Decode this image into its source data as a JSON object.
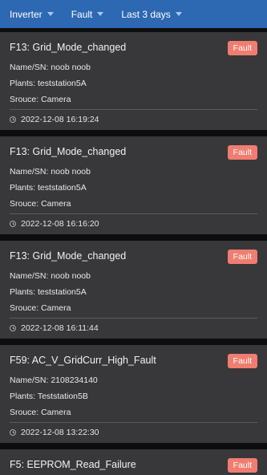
{
  "filters": [
    {
      "label": "Inverter",
      "icon": "caret-down-icon"
    },
    {
      "label": "Fault",
      "icon": "caret-down-icon"
    },
    {
      "label": "Last 3 days",
      "icon": "caret-down-icon"
    }
  ],
  "colors": {
    "header_bg": "#2d68b3",
    "card_bg": "#38383a",
    "badge_bg": "#ef7d70",
    "page_bg": "#0d0d0f"
  },
  "alerts": [
    {
      "title": "F13: Grid_Mode_changed",
      "badge": "Fault",
      "name_sn": "Name/SN: noob noob",
      "plants": "Plants: teststation5A",
      "source": "Srouce: Camera",
      "time": "2022-12-08 16:19:24"
    },
    {
      "title": "F13: Grid_Mode_changed",
      "badge": "Fault",
      "name_sn": "Name/SN: noob noob",
      "plants": "Plants: teststation5A",
      "source": "Srouce: Camera",
      "time": "2022-12-08 16:16:20"
    },
    {
      "title": "F13: Grid_Mode_changed",
      "badge": "Fault",
      "name_sn": "Name/SN: noob noob",
      "plants": "Plants: teststation5A",
      "source": "Srouce: Camera",
      "time": "2022-12-08 16:11:44"
    },
    {
      "title": "F59: AC_V_GridCurr_High_Fault",
      "badge": "Fault",
      "name_sn": "Name/SN: 2108234140",
      "plants": "Plants: Teststation5B",
      "source": "Srouce: Camera",
      "time": "2022-12-08 13:22:30"
    },
    {
      "title": "F5: EEPROM_Read_Failure",
      "badge": "Fault"
    }
  ]
}
